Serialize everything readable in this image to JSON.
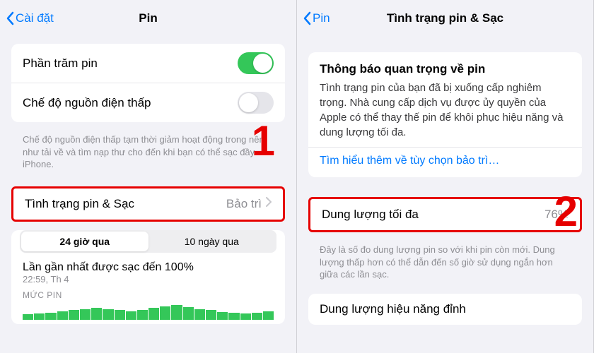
{
  "left": {
    "back": "Cài đặt",
    "title": "Pin",
    "rows": {
      "percent": "Phần trăm pin",
      "lowpower": "Chế độ nguồn điện thấp"
    },
    "footer": "Chế độ nguồn điện thấp tạm thời giảm hoạt động trong nền như tải về và tìm nạp thư cho đến khi bạn có thể sạc đầy iPhone.",
    "health_row": {
      "label": "Tình trạng pin & Sạc",
      "value": "Bảo trì"
    },
    "segmented": {
      "a": "24 giờ qua",
      "b": "10 ngày qua"
    },
    "charge_line": "Lần gần nhất được sạc đến 100%",
    "charge_time": "22:59, Th 4",
    "level_label": "MỨC PIN",
    "marker": "1"
  },
  "right": {
    "back": "Pin",
    "title": "Tình trạng pin & Sạc",
    "notice": {
      "title": "Thông báo quan trọng về pin",
      "body": "Tình trạng pin của bạn đã bị xuống cấp nghiêm trọng. Nhà cung cấp dịch vụ được ủy quyền của Apple có thể thay thế pin để khôi phục hiệu năng và dung lượng tối đa.",
      "link": "Tìm hiểu thêm về tùy chọn bảo trì…"
    },
    "capacity": {
      "label": "Dung lượng tối đa",
      "value": "76%"
    },
    "capacity_footer": "Đây là số đo dung lượng pin so với khi pin còn mới. Dung lượng thấp hơn có thể dẫn đến số giờ sử dụng ngắn hơn giữa các lần sạc.",
    "peak": "Dung lượng hiệu năng đỉnh",
    "marker": "2"
  }
}
